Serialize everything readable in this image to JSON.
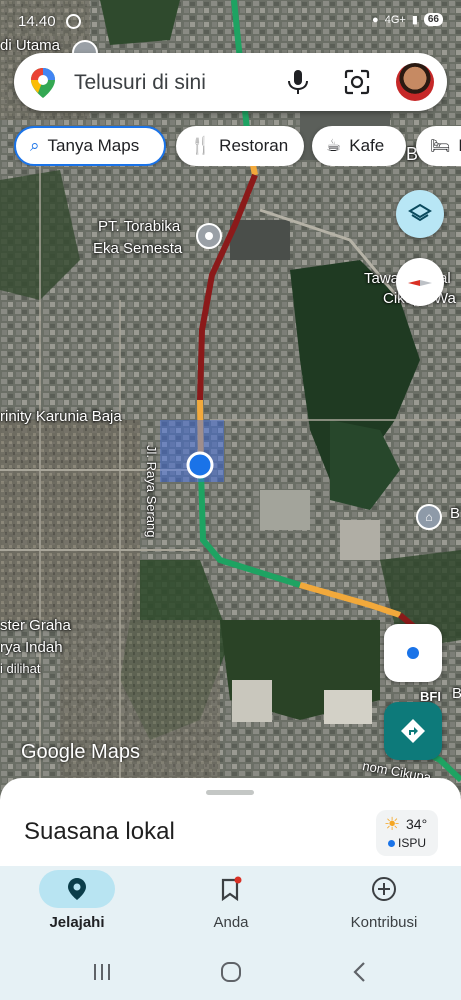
{
  "status_bar": {
    "time": "14.40",
    "network": "4G+",
    "battery": "66"
  },
  "search": {
    "placeholder": "Telusuri di sini"
  },
  "chips": [
    {
      "label": "Tanya Maps",
      "icon": "sparkle-search-icon"
    },
    {
      "label": "Restoran",
      "icon": "fork-knife-icon"
    },
    {
      "label": "Kafe",
      "icon": "coffee-cup-icon"
    },
    {
      "label": "H",
      "icon": "bed-icon"
    }
  ],
  "map_labels": {
    "top_left": "di Utama",
    "pt_torabika_1": "PT. Torabika",
    "pt_torabika_2": "Eka Semesta",
    "tawada_1": "Tawada Heal",
    "tawada_2": "Cikupa Wa",
    "trinity": "rinity Karunia Baja",
    "road": "Jl. Raya Serang",
    "graha_1": "ster Graha",
    "graha_2": "rya Indah",
    "graha_3": "i dilihat",
    "right_b1": "B",
    "right_b2": "B",
    "right_b3": "B",
    "cikupa": "nom Cikupa",
    "bfi": "BFI"
  },
  "branding": {
    "logo_text": "Google Maps"
  },
  "sheet": {
    "title": "Suasana lokal"
  },
  "weather": {
    "temp": "34°",
    "label": "ISPU"
  },
  "nav": [
    {
      "label": "Jelajahi",
      "icon": "location-pin-icon",
      "active": true
    },
    {
      "label": "Anda",
      "icon": "bookmark-icon",
      "active": false
    },
    {
      "label": "Kontribusi",
      "icon": "add-circle-icon",
      "active": false
    }
  ],
  "colors": {
    "accent": "#1a73e8",
    "traffic_heavy": "#8b1a1a",
    "traffic_slow": "#f2a93b",
    "traffic_free": "#1ea362",
    "nav_bg": "#e6f1f5"
  }
}
